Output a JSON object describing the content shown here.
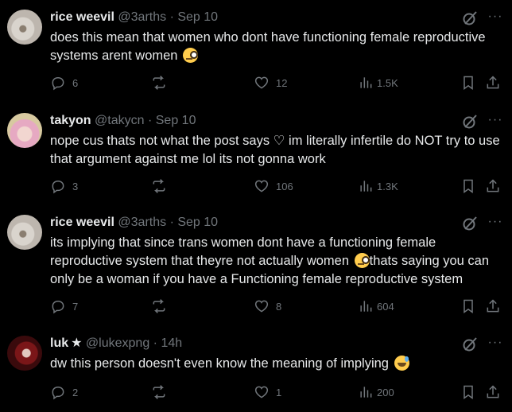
{
  "colors": {
    "background": "#000000",
    "text": "#e7e9ea",
    "muted": "#71767b"
  },
  "tweets": [
    {
      "name": "rice weevil",
      "handle": "@3arths",
      "time": "Sep 10",
      "text": "does this mean that women who dont have functioning female reproductive systems arent women",
      "emoji": "face-with-monocle",
      "replies": "6",
      "reposts": "",
      "likes": "12",
      "views": "1.5K"
    },
    {
      "name": "takyon",
      "handle": "@takycn",
      "time": "Sep 10",
      "text": "nope cus thats not what the post says ♡ im literally infertile do NOT try to use that argument against me lol its not gonna work",
      "replies": "3",
      "reposts": "",
      "likes": "106",
      "views": "1.3K"
    },
    {
      "name": "rice weevil",
      "handle": "@3arths",
      "time": "Sep 10",
      "text_before": "its implying that since trans women dont have a functioning female reproductive system that theyre not actually women",
      "text_after": "thats saying you can only be a woman if you have a Functioning female reproductive system",
      "emoji": "face-with-monocle",
      "replies": "7",
      "reposts": "",
      "likes": "8",
      "views": "604"
    },
    {
      "name": "luk",
      "name_badge": "★",
      "handle": "@lukexpng",
      "time": "14h",
      "text": "dw this person doesn't even know the meaning of implying",
      "emoji": "grinning-face-with-sweat",
      "replies": "2",
      "reposts": "",
      "likes": "1",
      "views": "200"
    }
  ],
  "separator": "·"
}
